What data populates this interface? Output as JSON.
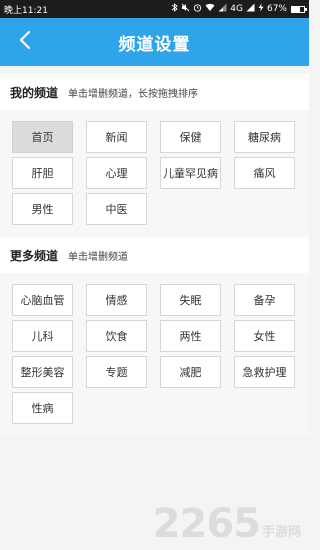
{
  "statusbar": {
    "time": "晚上11:21",
    "network": "4G",
    "battery_text": "67%",
    "battery_level": 0.67
  },
  "header": {
    "title": "频道设置",
    "back_icon": "chevron-left-icon"
  },
  "my_channels": {
    "title": "我的频道",
    "hint": "单击增删频道，长按拖拽排序",
    "items": [
      "首页",
      "新闻",
      "保健",
      "糖尿病",
      "肝胆",
      "心理",
      "儿童罕见病",
      "痛风",
      "男性",
      "中医"
    ],
    "selected": "首页"
  },
  "more_channels": {
    "title": "更多频道",
    "hint": "单击增删频道",
    "items": [
      "心脑血管",
      "情感",
      "失眠",
      "备孕",
      "儿科",
      "饮食",
      "两性",
      "女性",
      "整形美容",
      "专题",
      "减肥",
      "急救护理",
      "性病"
    ]
  },
  "watermark": {
    "logo": "2265",
    "site": "手游网"
  },
  "colors": {
    "header_bg": "#2ea5ea",
    "status_bg": "#1c1c1c",
    "chip_active_bg": "#dcdcdc"
  }
}
